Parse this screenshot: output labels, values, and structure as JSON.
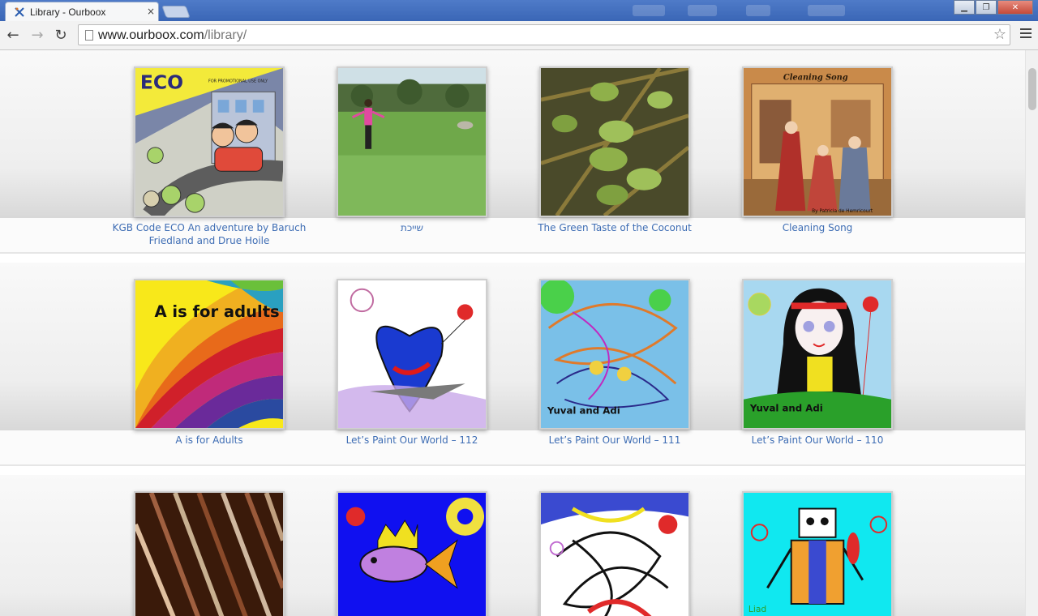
{
  "browser": {
    "tab_title": "Library - Ourboox",
    "tab_close": "×",
    "url_host": "www.ourboox.com",
    "url_path": "/library/"
  },
  "books": [
    {
      "title": "KGB Code ECO An adventure by Baruch Friedland and Drue Hoile",
      "cover_text": "ECO",
      "cover_subtext": "FOR PROMOTIONAL USE ONLY"
    },
    {
      "title": "שייכת"
    },
    {
      "title": "The Green Taste of the Coconut"
    },
    {
      "title": "Cleaning Song",
      "cover_text": "Cleaning Song",
      "cover_subtext": "By Patricia de Hemricourt"
    },
    {
      "title": "A is for Adults",
      "cover_text": "A is for adults"
    },
    {
      "title": "Let’s Paint Our World – 112"
    },
    {
      "title": "Let’s Paint Our World – 111",
      "cover_text": "Yuval and Adi"
    },
    {
      "title": "Let’s Paint Our World – 110",
      "cover_text": "Yuval and Adi"
    },
    {
      "title": ""
    },
    {
      "title": ""
    },
    {
      "title": ""
    },
    {
      "title": "",
      "cover_text": "Liad"
    }
  ],
  "colors": {
    "link": "#3e6db4",
    "shelf": "#eeeeee"
  },
  "icons": [
    "ourboox-favicon-icon",
    "back-arrow-icon",
    "forward-arrow-icon",
    "reload-icon",
    "page-icon",
    "star-icon",
    "menu-icon"
  ]
}
